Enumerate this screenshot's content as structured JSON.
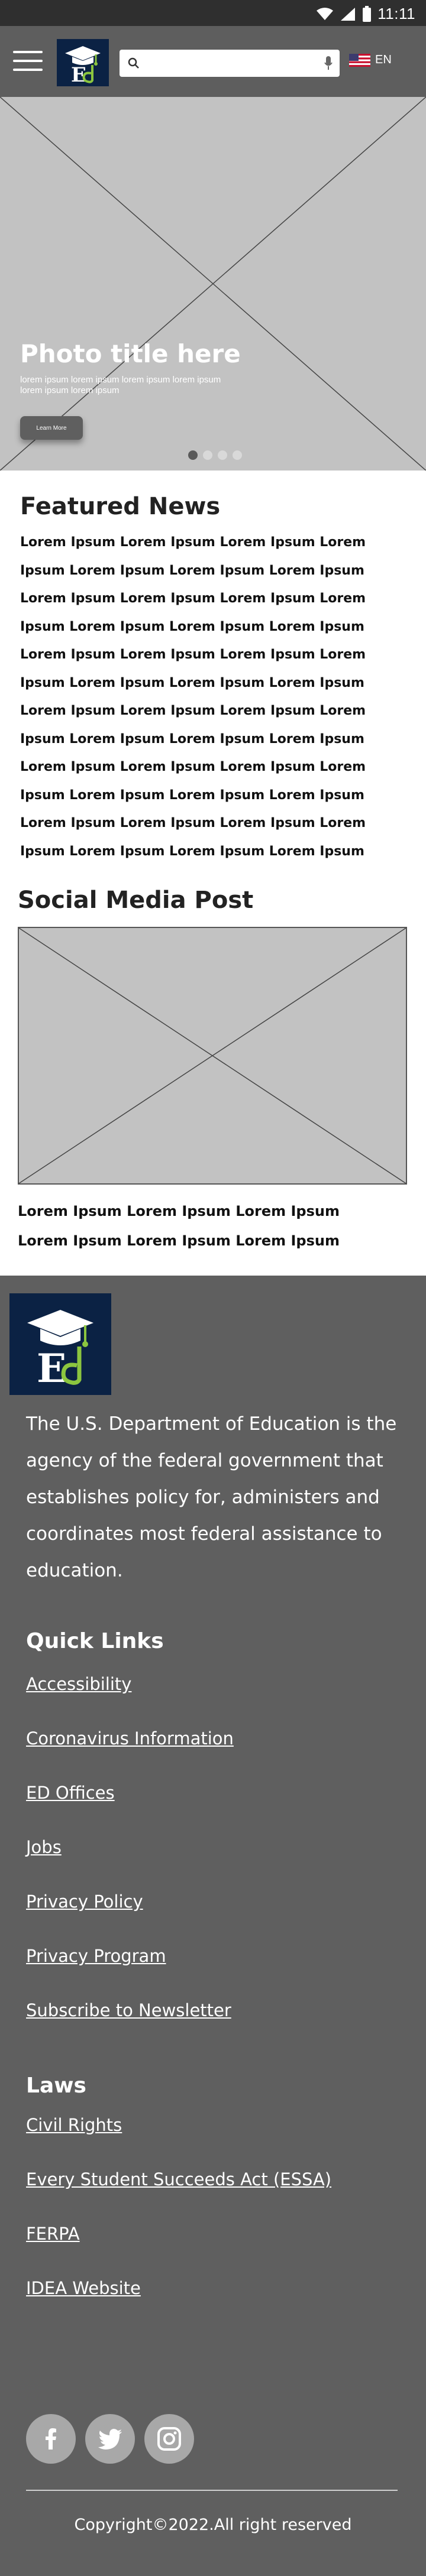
{
  "status_bar": {
    "time": "11:11",
    "icons": [
      "wifi-icon",
      "signal-icon",
      "battery-icon"
    ]
  },
  "header": {
    "menu_icon": "hamburger-menu-icon",
    "logo_icon": "ed-logo-icon",
    "search": {
      "placeholder": "",
      "value": "",
      "icon": "search-icon",
      "mic_icon": "microphone-icon"
    },
    "language": {
      "flag_icon": "us-flag-icon",
      "label": "EN"
    }
  },
  "hero": {
    "title": "Photo title here",
    "subtitle": "lorem ipsum lorem ipsum lorem ipsum lorem ipsum lorem ipsum lorem ipsum",
    "button_label": "Learn More",
    "slides": 4,
    "active_slide": 1
  },
  "featured": {
    "title": "Featured News",
    "lines": [
      "Lorem Ipsum Lorem Ipsum Lorem Ipsum Lorem",
      "Ipsum Lorem Ipsum Lorem Ipsum Lorem Ipsum",
      "Lorem Ipsum Lorem Ipsum Lorem Ipsum Lorem",
      "Ipsum Lorem Ipsum Lorem Ipsum Lorem Ipsum",
      "Lorem Ipsum Lorem Ipsum Lorem Ipsum Lorem",
      "Ipsum Lorem Ipsum Lorem Ipsum Lorem Ipsum",
      "Lorem Ipsum Lorem Ipsum Lorem Ipsum Lorem",
      "Ipsum Lorem Ipsum Lorem Ipsum Lorem Ipsum",
      "Lorem Ipsum Lorem Ipsum Lorem Ipsum Lorem",
      "Ipsum Lorem Ipsum Lorem Ipsum Lorem Ipsum",
      "Lorem Ipsum Lorem Ipsum Lorem Ipsum Lorem",
      "Ipsum Lorem Ipsum Lorem Ipsum Lorem Ipsum"
    ]
  },
  "social_post": {
    "title": "Social Media Post",
    "lines": [
      "Lorem Ipsum Lorem Ipsum Lorem Ipsum",
      "Lorem Ipsum Lorem Ipsum Lorem Ipsum"
    ]
  },
  "footer": {
    "description": "The U.S. Department of Education is the agency of the federal government that establishes policy for, administers and coordinates most federal assistance to education.",
    "quick_links_title": "Quick Links",
    "quick_links": [
      "Accessibility",
      "Coronavirus Information",
      "ED Offices",
      "Jobs",
      "Privacy Policy",
      "Privacy Program",
      "Subscribe to Newsletter"
    ],
    "laws_title": "Laws",
    "laws": [
      "Civil Rights",
      "Every Student Succeeds Act (ESSA)",
      "FERPA",
      "IDEA Website"
    ],
    "social_icons": [
      "facebook-icon",
      "twitter-icon",
      "instagram-icon"
    ],
    "copyright": "Copyright©2022.All right reserved"
  },
  "colors": {
    "status_bar": "#2f2f2f",
    "header": "#5e5e5e",
    "hero_placeholder": "#c2c2c2",
    "logo_navy": "#0b2244",
    "logo_green": "#8cc63f",
    "footer": "#5f5f5f"
  }
}
